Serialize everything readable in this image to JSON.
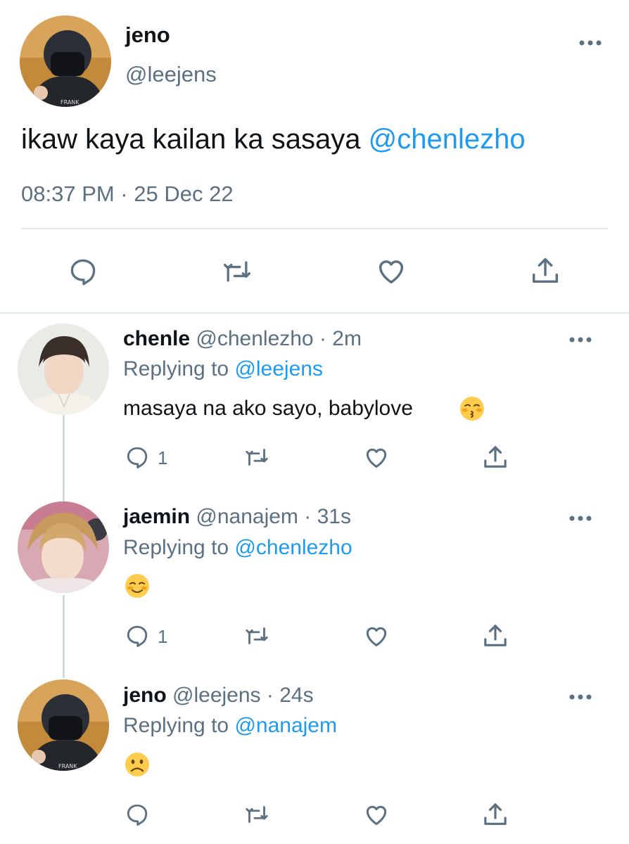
{
  "main_tweet": {
    "display_name": "jeno",
    "handle": "@leejens",
    "text": "ikaw kaya kailan ka sasaya",
    "mention": "@chenlezho",
    "timestamp": "08:37 PM · 25 Dec 22"
  },
  "replies": [
    {
      "display_name": "chenle",
      "handle_time": "@chenlezho · 2m",
      "replying_prefix": "Replying to",
      "replying_to": "@leejens",
      "text": "masaya na ako sayo, babylove",
      "emoji": "kissing-face-with-closed-eyes",
      "reply_count": "1"
    },
    {
      "display_name": "jaemin",
      "handle_time": "@nanajem · 31s",
      "replying_prefix": "Replying to",
      "replying_to": "@chenlezho",
      "emoji": "smiling-face",
      "reply_count": "1"
    },
    {
      "display_name": "jeno",
      "handle_time": "@leejens · 24s",
      "replying_prefix": "Replying to",
      "replying_to": "@nanajem",
      "emoji": "frowning-face"
    }
  ],
  "colors": {
    "accent": "#1d9bf0",
    "muted": "#5b7083",
    "divider": "#e1e8ed"
  }
}
